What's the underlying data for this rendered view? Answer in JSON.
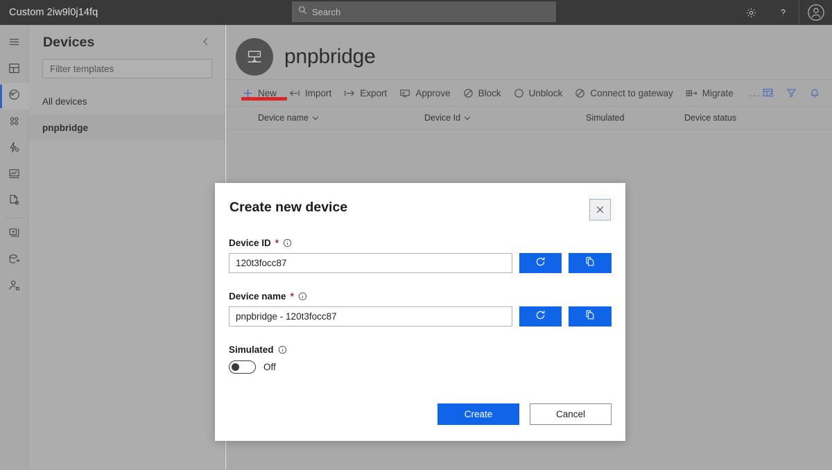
{
  "topbar": {
    "brand": "Custom 2iw9l0j14fq",
    "search_placeholder": "Search",
    "settings_icon": "gear-icon",
    "help_icon": "question-mark-icon",
    "avatar_icon": "user-avatar-icon"
  },
  "rail": {
    "items": [
      {
        "name": "menu-icon",
        "label": "Menu"
      },
      {
        "name": "dashboard-icon",
        "label": "Dashboard"
      },
      {
        "name": "devices-icon",
        "label": "Devices"
      },
      {
        "name": "device-groups-icon",
        "label": "Device groups"
      },
      {
        "name": "rules-icon",
        "label": "Rules"
      },
      {
        "name": "analytics-icon",
        "label": "Analytics"
      },
      {
        "name": "jobs-icon",
        "label": "Jobs"
      },
      {
        "name": "device-templates-icon",
        "label": "Device templates"
      },
      {
        "name": "data-export-icon",
        "label": "Data export"
      },
      {
        "name": "administration-icon",
        "label": "Administration"
      }
    ],
    "selected_index": 2
  },
  "panel": {
    "title": "Devices",
    "collapse_icon": "chevron-left-icon",
    "filter_placeholder": "Filter templates",
    "items": [
      {
        "label": "All devices",
        "active": false
      },
      {
        "label": "pnpbridge",
        "active": true
      }
    ]
  },
  "main": {
    "device_icon": "gateway-device-icon",
    "title": "pnpbridge",
    "commands": [
      {
        "label": "New",
        "icon": "plus-icon"
      },
      {
        "label": "Import",
        "icon": "import-arrow-icon"
      },
      {
        "label": "Export",
        "icon": "export-arrow-icon"
      },
      {
        "label": "Approve",
        "icon": "approve-screen-icon"
      },
      {
        "label": "Block",
        "icon": "block-circle-icon"
      },
      {
        "label": "Unblock",
        "icon": "unblock-circle-icon"
      },
      {
        "label": "Connect to gateway",
        "icon": "connect-gateway-icon"
      },
      {
        "label": "Migrate",
        "icon": "migrate-arrow-icon"
      }
    ],
    "overflow_label": "...",
    "right_icons": [
      {
        "name": "column-options-icon"
      },
      {
        "name": "filter-funnel-icon"
      },
      {
        "name": "notification-bell-icon"
      }
    ],
    "table": {
      "columns": [
        {
          "label": "Device name",
          "sortable": true
        },
        {
          "label": "Device Id",
          "sortable": true
        },
        {
          "label": "Simulated",
          "sortable": false
        },
        {
          "label": "Device status",
          "sortable": false
        }
      ],
      "rows": []
    },
    "annotation": {
      "type": "red-underline",
      "target": "New"
    }
  },
  "modal": {
    "title": "Create new device",
    "close_icon": "close-x-icon",
    "fields": {
      "device_id": {
        "label": "Device ID",
        "required_mark": "*",
        "info_icon": "info-icon",
        "value": "120t3focc87",
        "refresh_icon": "refresh-icon",
        "copy_icon": "copy-icon"
      },
      "device_name": {
        "label": "Device name",
        "required_mark": "*",
        "info_icon": "info-icon",
        "value": "pnpbridge - 120t3focc87",
        "refresh_icon": "refresh-icon",
        "copy_icon": "copy-icon"
      },
      "simulated": {
        "label": "Simulated",
        "info_icon": "info-icon",
        "state_label": "Off",
        "checked": false
      }
    },
    "create_label": "Create",
    "cancel_label": "Cancel"
  },
  "colors": {
    "accent_blue": "#1064e8",
    "topbar_bg": "#2b2b2b",
    "page_bg": "#b4b4b4",
    "annotation_red": "#f01414",
    "required_red": "#c21f2e"
  }
}
